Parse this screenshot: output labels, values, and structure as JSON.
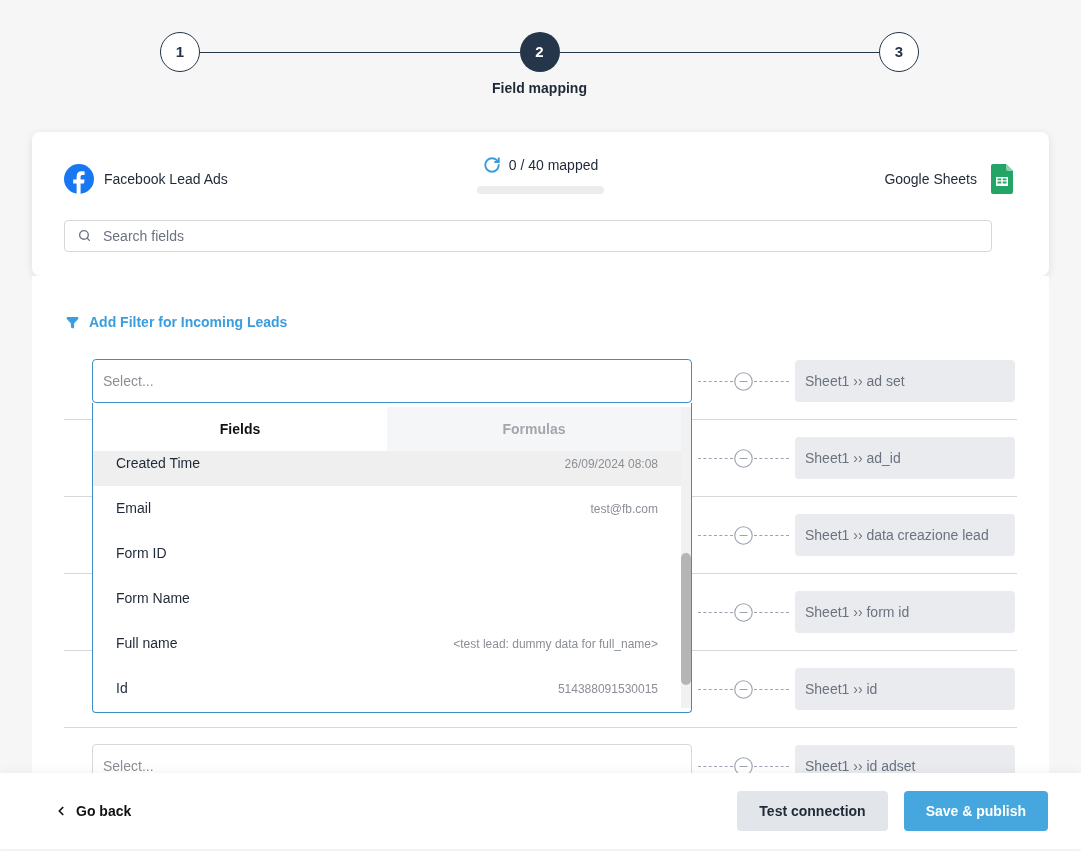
{
  "stepper": {
    "steps": [
      {
        "number": "1",
        "selected": false
      },
      {
        "number": "2",
        "selected": true,
        "label": "Field mapping"
      },
      {
        "number": "3",
        "selected": false
      }
    ]
  },
  "header": {
    "source": "Facebook Lead Ads",
    "progress": {
      "text": "0 / 40 mapped",
      "level": 0
    },
    "destination": "Google Sheets",
    "search": {
      "placeholder": "Search fields"
    }
  },
  "filter_link": "Add Filter for Incoming Leads",
  "rows": [
    {
      "select": {
        "placeholder": "Select...",
        "focused": true
      },
      "target": "Sheet1 ›› ad set"
    },
    {
      "target": "Sheet1 ›› ad_id"
    },
    {
      "target": "Sheet1 ›› data creazione lead"
    },
    {
      "target": "Sheet1 ›› form id"
    },
    {
      "target": "Sheet1 ›› id"
    },
    {
      "select": {
        "placeholder": "Select...",
        "focused": false
      },
      "target": "Sheet1 ›› id adset"
    }
  ],
  "dropdown": {
    "tabs": [
      {
        "label": "Fields",
        "selected": true
      },
      {
        "label": "Formulas",
        "selected": false
      }
    ],
    "items": [
      {
        "name": "Created Time",
        "value": "26/09/2024 08:08",
        "highlighted": true
      },
      {
        "name": "Email",
        "value": "test@fb.com",
        "highlighted": false
      },
      {
        "name": "Form ID",
        "highlighted": false
      },
      {
        "name": "Form Name",
        "highlighted": false
      },
      {
        "name": "Full name",
        "value": "<test lead: dummy data for full_name>",
        "highlighted": false
      },
      {
        "name": "Id",
        "value": "514388091530015",
        "highlighted": false
      }
    ]
  },
  "footer": {
    "back": "Go back",
    "buttons": [
      {
        "label": "Test connection",
        "kind": "secondary"
      },
      {
        "label": "Save & publish",
        "kind": "primary"
      }
    ]
  }
}
